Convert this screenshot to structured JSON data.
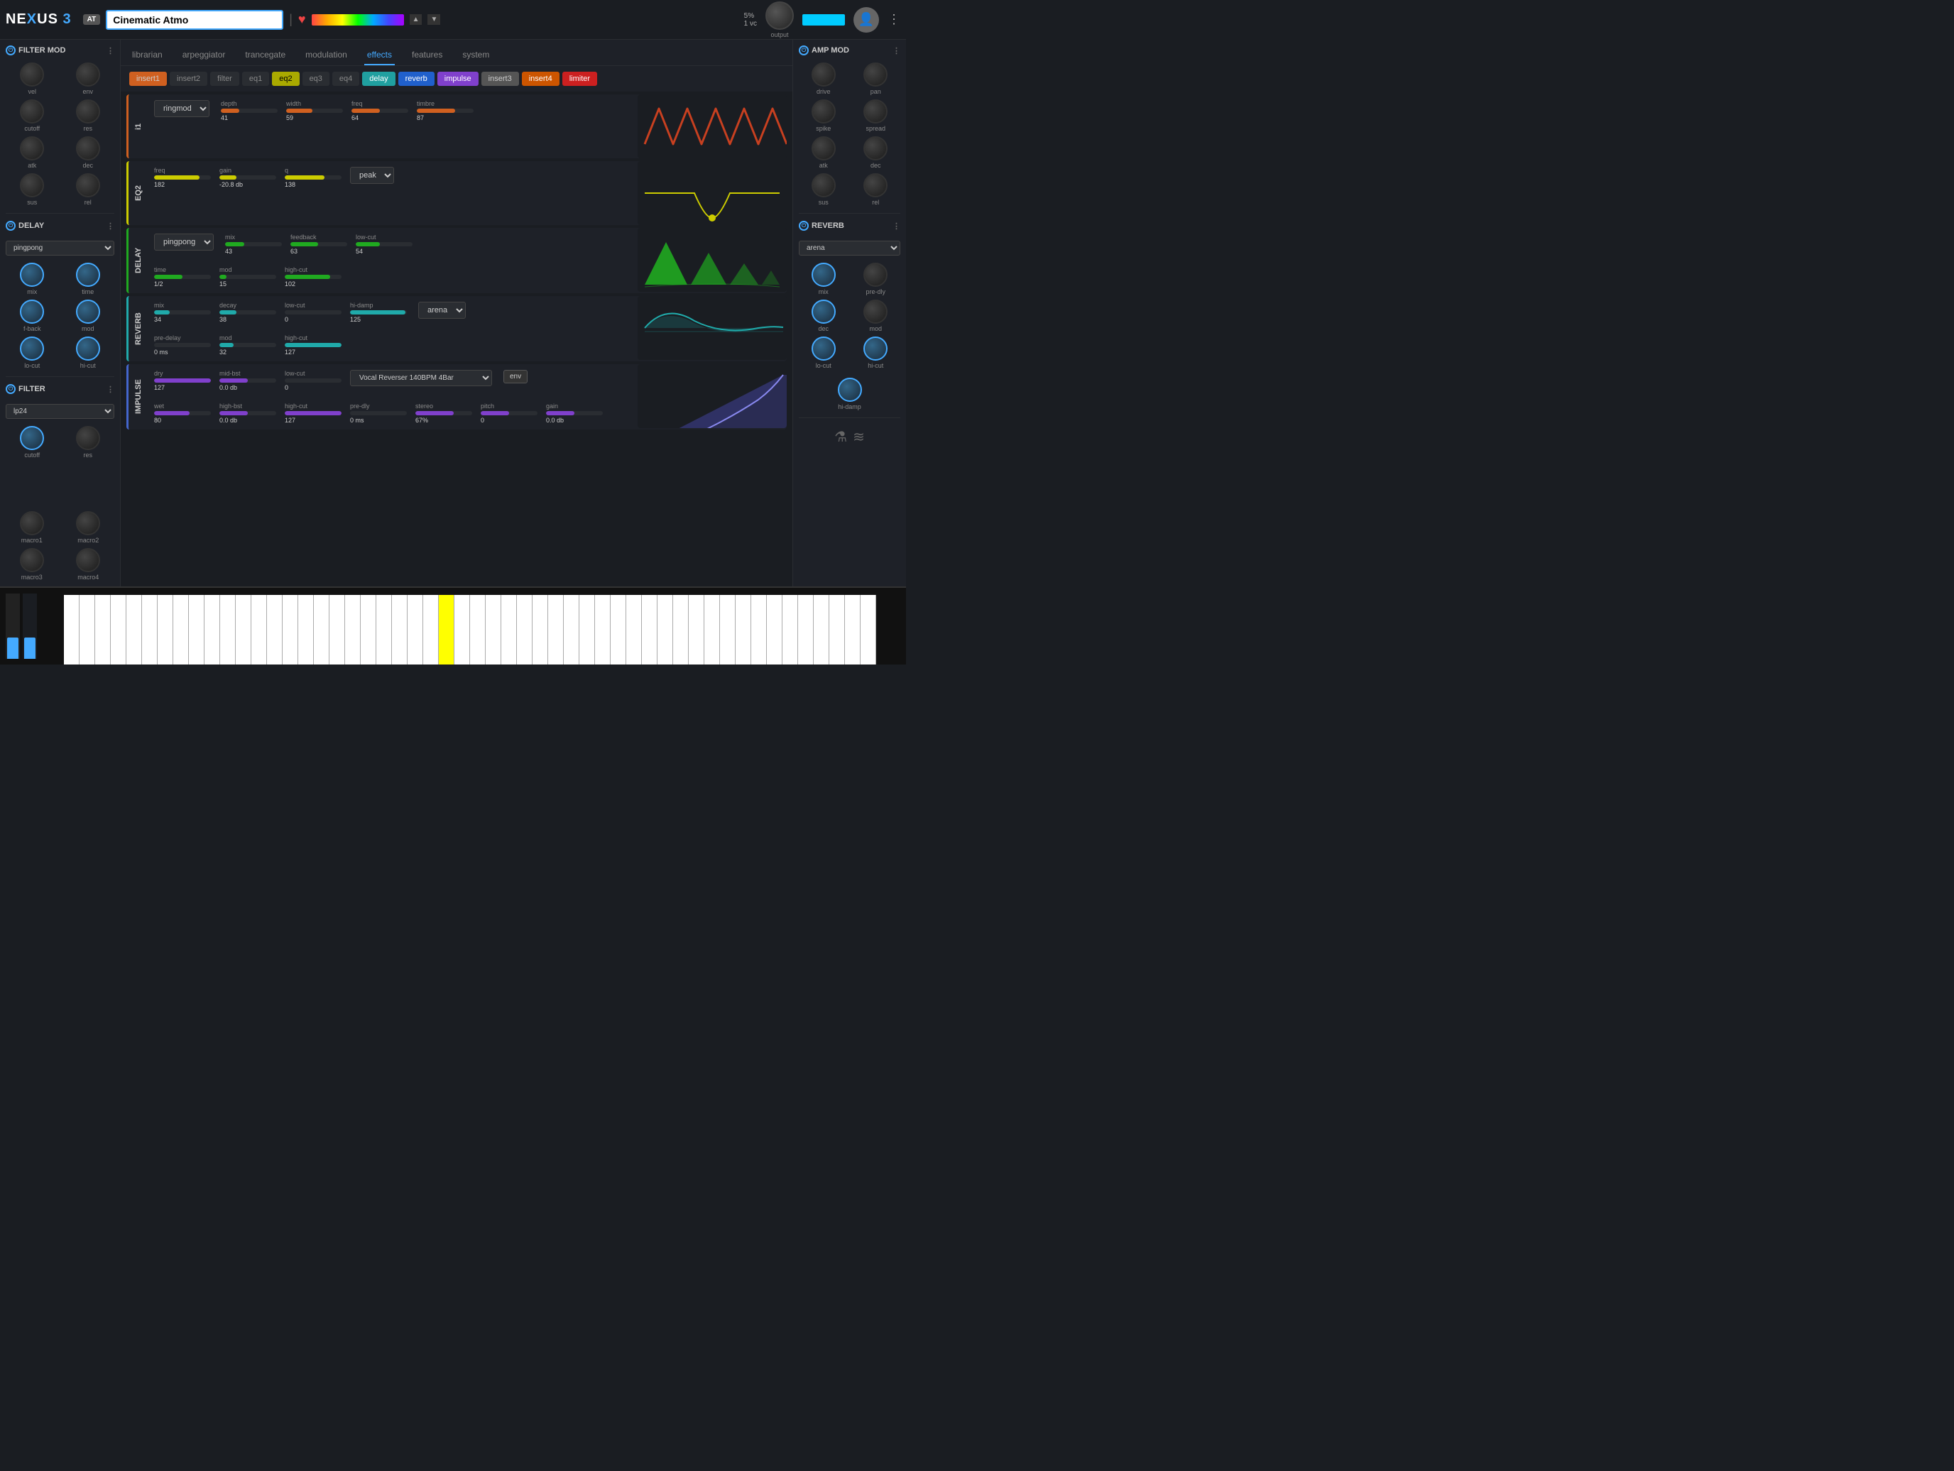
{
  "app": {
    "name": "NEXUS",
    "version": "3"
  },
  "topbar": {
    "preset_tag": "AT",
    "preset_name": "Cinematic Atmo",
    "bpm": "5%",
    "voices": "1 vc",
    "output_label": "output"
  },
  "nav_tabs": {
    "items": [
      "librarian",
      "arpeggiator",
      "trancegate",
      "modulation",
      "effects",
      "features",
      "system"
    ],
    "active": "effects"
  },
  "effects_tabs": {
    "items": [
      {
        "label": "insert1",
        "color": "orange"
      },
      {
        "label": "insert2",
        "color": "dark"
      },
      {
        "label": "filter",
        "color": "dark"
      },
      {
        "label": "eq1",
        "color": "dark"
      },
      {
        "label": "eq2",
        "color": "yellow"
      },
      {
        "label": "eq3",
        "color": "dark"
      },
      {
        "label": "eq4",
        "color": "dark"
      },
      {
        "label": "delay",
        "color": "teal"
      },
      {
        "label": "reverb",
        "color": "blue"
      },
      {
        "label": "impulse",
        "color": "purple"
      },
      {
        "label": "insert3",
        "color": "gray"
      },
      {
        "label": "insert4",
        "color": "orange2"
      },
      {
        "label": "limiter",
        "color": "red"
      }
    ]
  },
  "effects": {
    "i1": {
      "label": "i1",
      "type": "ringmod",
      "type_label": "ringmod",
      "params": {
        "depth": {
          "label": "depth",
          "value": "41",
          "pct": 32
        },
        "width": {
          "label": "width",
          "value": "59",
          "pct": 46
        },
        "freq": {
          "label": "freq",
          "value": "64",
          "pct": 50
        },
        "timbre": {
          "label": "timbre",
          "value": "87",
          "pct": 68
        }
      }
    },
    "eq2": {
      "label": "EQ2",
      "params": {
        "freq": {
          "label": "freq",
          "value": "182",
          "pct": 80
        },
        "gain": {
          "label": "gain",
          "value": "-20.8 db",
          "pct": 30
        },
        "q": {
          "label": "q",
          "value": "138",
          "pct": 70
        }
      },
      "filter_type": "peak"
    },
    "delay": {
      "label": "DELAY",
      "type": "pingpong",
      "params": {
        "mix": {
          "label": "mix",
          "value": "43",
          "pct": 34
        },
        "feedback": {
          "label": "feedback",
          "value": "63",
          "pct": 49
        },
        "low_cut": {
          "label": "low-cut",
          "value": "54",
          "pct": 42
        },
        "time": {
          "label": "time",
          "value": "1/2",
          "pct": 50
        },
        "mod": {
          "label": "mod",
          "value": "15",
          "pct": 12
        },
        "high_cut": {
          "label": "high-cut",
          "value": "102",
          "pct": 80
        }
      }
    },
    "reverb": {
      "label": "REVERB",
      "type": "arena",
      "params": {
        "mix": {
          "label": "mix",
          "value": "34",
          "pct": 27
        },
        "decay": {
          "label": "decay",
          "value": "38",
          "pct": 30
        },
        "low_cut": {
          "label": "low-cut",
          "value": "0",
          "pct": 0
        },
        "hi_damp": {
          "label": "hi-damp",
          "value": "125",
          "pct": 98
        },
        "pre_delay": {
          "label": "pre-delay",
          "value": "0 ms",
          "pct": 0
        },
        "mod": {
          "label": "mod",
          "value": "32",
          "pct": 25
        },
        "high_cut": {
          "label": "high-cut",
          "value": "127",
          "pct": 100
        }
      }
    },
    "impulse": {
      "label": "IMPULSE",
      "preset": "Vocal Reverser 140BPM 4Bar",
      "params": {
        "dry": {
          "label": "dry",
          "value": "127",
          "pct": 100
        },
        "mid_bst": {
          "label": "mid-bst",
          "value": "0.0 db",
          "pct": 50
        },
        "low_cut": {
          "label": "low-cut",
          "value": "0",
          "pct": 0
        },
        "wet": {
          "label": "wet",
          "value": "80",
          "pct": 63
        },
        "high_bst": {
          "label": "high-bst",
          "value": "0.0 db",
          "pct": 50
        },
        "high_cut": {
          "label": "high-cut",
          "value": "127",
          "pct": 100
        },
        "pre_dly": {
          "label": "pre-dly",
          "value": "0 ms",
          "pct": 0
        },
        "stereo": {
          "label": "stereo",
          "value": "67%",
          "pct": 67
        },
        "pitch": {
          "label": "pitch",
          "value": "0",
          "pct": 50
        },
        "gain": {
          "label": "gain",
          "value": "0.0 db",
          "pct": 50
        }
      }
    }
  },
  "filter_mod": {
    "title": "FILTER MOD",
    "knobs": [
      {
        "label": "vel",
        "blue": false
      },
      {
        "label": "env",
        "blue": false
      },
      {
        "label": "cutoff",
        "blue": false
      },
      {
        "label": "res",
        "blue": false
      },
      {
        "label": "atk",
        "blue": false
      },
      {
        "label": "dec",
        "blue": false
      },
      {
        "label": "sus",
        "blue": false
      },
      {
        "label": "rel",
        "blue": false
      }
    ]
  },
  "delay_sidebar": {
    "title": "DELAY",
    "type": "pingpong",
    "knobs": [
      {
        "label": "mix",
        "blue": true
      },
      {
        "label": "time",
        "blue": true
      },
      {
        "label": "f-back",
        "blue": true
      },
      {
        "label": "mod",
        "blue": true
      },
      {
        "label": "lo-cut",
        "blue": true
      },
      {
        "label": "hi-cut",
        "blue": true
      }
    ]
  },
  "filter_sidebar": {
    "title": "FILTER",
    "type": "lp24",
    "knobs": [
      {
        "label": "cutoff",
        "blue": true
      },
      {
        "label": "res",
        "blue": false
      }
    ]
  },
  "amp_mod": {
    "title": "AMP MOD",
    "knobs": [
      {
        "label": "drive",
        "blue": false
      },
      {
        "label": "pan",
        "blue": false
      },
      {
        "label": "spike",
        "blue": false
      },
      {
        "label": "spread",
        "blue": false
      },
      {
        "label": "atk",
        "blue": false
      },
      {
        "label": "dec",
        "blue": false
      },
      {
        "label": "sus",
        "blue": false
      },
      {
        "label": "rel",
        "blue": false
      }
    ]
  },
  "reverb_sidebar": {
    "title": "REVERB",
    "type": "arena",
    "knobs": [
      {
        "label": "mix",
        "blue": true
      },
      {
        "label": "pre-dly",
        "blue": false
      },
      {
        "label": "dec",
        "blue": true
      },
      {
        "label": "mod",
        "blue": false
      },
      {
        "label": "lo-cut",
        "blue": true
      },
      {
        "label": "hi-cut",
        "blue": true
      },
      {
        "label": "hi-damp",
        "blue": true
      }
    ]
  },
  "macros": [
    {
      "label": "macro1"
    },
    {
      "label": "macro2"
    },
    {
      "label": "macro3"
    },
    {
      "label": "macro4"
    }
  ]
}
